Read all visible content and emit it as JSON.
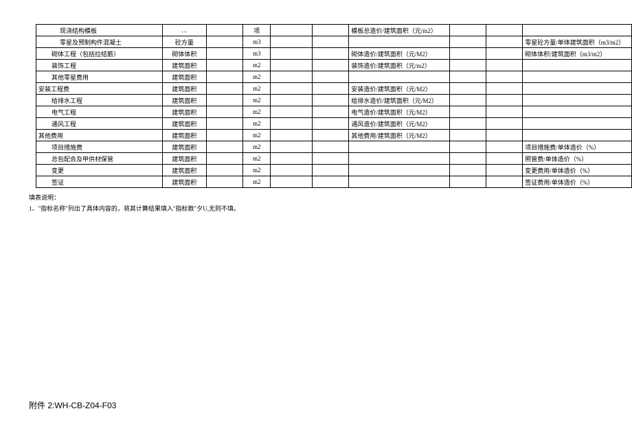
{
  "rows": [
    {
      "c1": "现浇结构模板",
      "c1cls": "indent2",
      "c2": "…",
      "c4": "项",
      "c7": "模板总造价/建筑面积（元/m2）",
      "c10": ""
    },
    {
      "c1": "零星及预制构件混凝土",
      "c1cls": "indent2",
      "c2": "砼方量",
      "c4": "m3",
      "c7": "",
      "c10": "零星砼方量/单体建筑面积（m3/m2）"
    },
    {
      "c1": "砌体工程（包括拉结筋）",
      "c1cls": "indent1",
      "c2": "砌体体积",
      "c4": "m3",
      "c7": "砌体造价/建筑面积（元/M2）",
      "c10": "砌体体积/建筑面积（m3/m2）"
    },
    {
      "c1": "装饰工程",
      "c1cls": "indent1",
      "c2": "建筑面积",
      "c4": "m2",
      "c7": "装饰造价/建筑面积（元/m2）",
      "c10": ""
    },
    {
      "c1": "其他零星费用",
      "c1cls": "indent1",
      "c2": "建筑面积",
      "c4": "m2",
      "c7": "",
      "c10": ""
    },
    {
      "c1": "安装工程费",
      "c1cls": "",
      "c2": "建筑面积",
      "c4": "m2",
      "c7": "安装造价/建筑面积（元/M2）",
      "c10": ""
    },
    {
      "c1": "给排水工程",
      "c1cls": "indent1",
      "c2": "建筑面积",
      "c4": "m2",
      "c7": "给排水造价/建筑面积（元/M2）",
      "c10": ""
    },
    {
      "c1": "电气工程",
      "c1cls": "indent1",
      "c2": "建筑面积",
      "c4": "m2",
      "c7": "电气造价/建筑面积（元/M2）",
      "c10": ""
    },
    {
      "c1": "通风工程",
      "c1cls": "indent1",
      "c2": "建筑面积",
      "c4": "m2",
      "c7": "通风造价/建筑面积（元/M2）",
      "c10": ""
    },
    {
      "c1": "其他费用",
      "c1cls": "",
      "c2": "建筑面积",
      "c4": "m2",
      "c7": "其他费用/建筑面积（元/M2）",
      "c10": ""
    },
    {
      "c1": "项目措施费",
      "c1cls": "indent1",
      "c2": "建筑面积",
      "c4": "m2",
      "c7": "",
      "c10": "项目措施费/单体造价（%）"
    },
    {
      "c1": "总包配合及甲供材保管",
      "c1cls": "indent1",
      "c2": "建筑面积",
      "c4": "m2",
      "c7": "",
      "c10": "照管费/单体造价（%）"
    },
    {
      "c1": "变更",
      "c1cls": "indent1",
      "c2": "建筑面积",
      "c4": "m2",
      "c7": "",
      "c10": "变更费用/单体造价（%）"
    },
    {
      "c1": "签证",
      "c1cls": "indent1",
      "c2": "建筑面积",
      "c4": "m2",
      "c7": "",
      "c10": "签证费用/单体造价（%）"
    }
  ],
  "notes": {
    "title": "填表说明：",
    "line1": "1、\"指标名称\"列出了具体内容的，将其计算结果填入\"指标数\"夕U,无则不填。"
  },
  "footer": "附件 2:WH-CB-Z04-F03"
}
